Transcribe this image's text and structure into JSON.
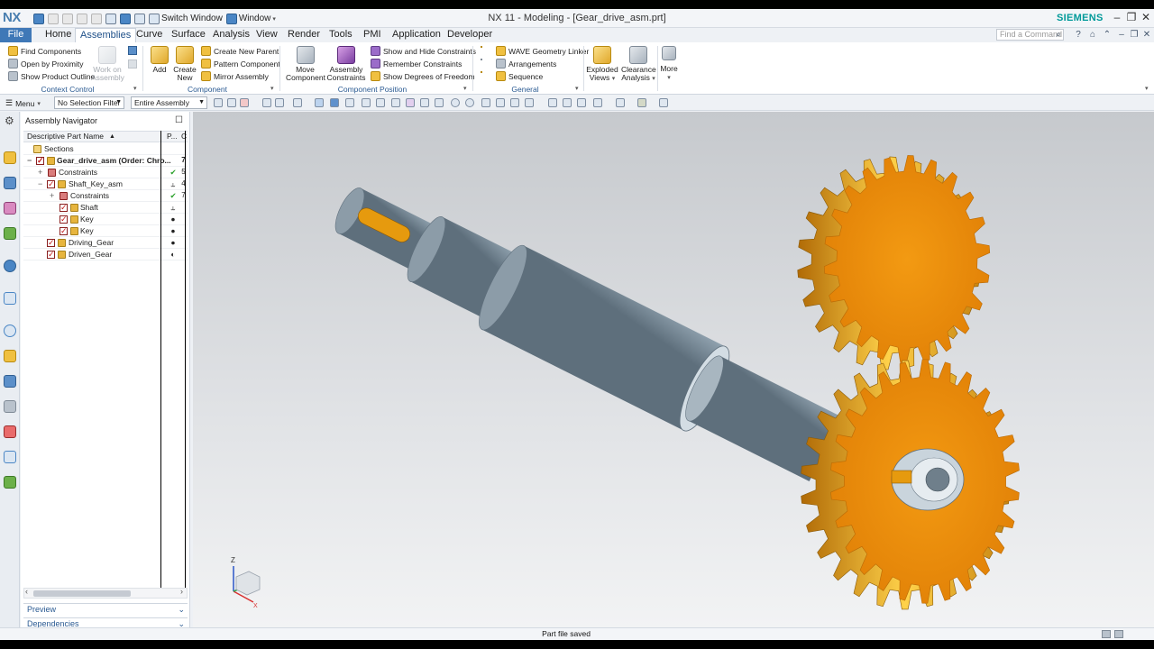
{
  "window": {
    "logo": "NX",
    "title": "NX 11 - Modeling - [Gear_drive_asm.prt]",
    "brand": "SIEMENS",
    "switch_window": "Switch Window",
    "window_menu": "Window"
  },
  "tabs": [
    "File",
    "Home",
    "Assemblies",
    "Curve",
    "Surface",
    "Analysis",
    "View",
    "Render",
    "Tools",
    "PMI",
    "Application",
    "Developer"
  ],
  "active_tab": "Assemblies",
  "command_search_placeholder": "Find a Command",
  "ribbon": {
    "context_control": {
      "label": "Context Control",
      "find_components": "Find Components",
      "open_by_proximity": "Open by Proximity",
      "show_product_outline": "Show Product Outline",
      "work_on_assembly": "Work on Assembly"
    },
    "component": {
      "label": "Component",
      "add": "Add",
      "create_new": "Create New",
      "create_new_parent": "Create New Parent",
      "pattern_component": "Pattern Component",
      "mirror_assembly": "Mirror Assembly"
    },
    "component_position": {
      "label": "Component Position",
      "move_component": "Move Component",
      "assembly_constraints": "Assembly Constraints",
      "show_hide_constraints": "Show and Hide Constraints",
      "remember_constraints": "Remember Constraints",
      "show_degrees_of_freedom": "Show Degrees of Freedom"
    },
    "general": {
      "label": "General",
      "wave_geometry_linker": "WAVE Geometry Linker",
      "arrangements": "Arrangements",
      "sequence": "Sequence"
    },
    "exploded_views": "Exploded Views",
    "clearance_analysis": "Clearance Analysis",
    "more": "More"
  },
  "selection_bar": {
    "menu": "Menu",
    "selection_filter": "No Selection Filter",
    "scope": "Entire Assembly"
  },
  "navigator": {
    "title": "Assembly Navigator",
    "col_name": "Descriptive Part Name",
    "col_p": "P...",
    "col_c": "C",
    "rows": [
      {
        "name": "Sections",
        "c1": "",
        "c2": ""
      },
      {
        "name": "Gear_drive_asm (Order: Chro...",
        "c1": "",
        "c2": "7"
      },
      {
        "name": "Constraints",
        "c1": "✔",
        "c2": "5"
      },
      {
        "name": "Shaft_Key_asm",
        "c1": "⥿",
        "c2": "4"
      },
      {
        "name": "Constraints",
        "c1": "✔",
        "c2": "7"
      },
      {
        "name": "Shaft",
        "c1": "⥿",
        "c2": ""
      },
      {
        "name": "Key",
        "c1": "●",
        "c2": ""
      },
      {
        "name": "Key",
        "c1": "●",
        "c2": ""
      },
      {
        "name": "Driving_Gear",
        "c1": "●",
        "c2": ""
      },
      {
        "name": "Driven_Gear",
        "c1": "◐",
        "c2": ""
      }
    ],
    "preview": "Preview",
    "dependencies": "Dependencies"
  },
  "triad": {
    "z": "Z",
    "x": "X"
  },
  "status": "Part file saved",
  "colors": {
    "gear": "#e88a0a",
    "shaft": "#8fa3b3",
    "accent": "#3f78b7"
  }
}
